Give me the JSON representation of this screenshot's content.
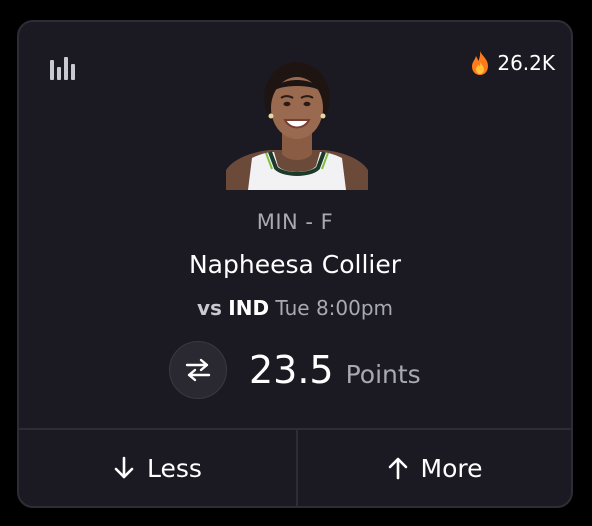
{
  "card": {
    "popularity_count": "26.2K",
    "popularity_icon": "flame-icon",
    "stats_icon": "bar-chart-icon",
    "player": {
      "team_position": "MIN - F",
      "name": "Napheesa Collier"
    },
    "matchup": {
      "vs_label": "vs",
      "opponent": "IND",
      "time": "Tue 8:00pm"
    },
    "projection": {
      "line": "23.5",
      "stat": "Points",
      "swap_icon": "swap-arrows-icon"
    },
    "actions": {
      "less_label": "Less",
      "less_icon": "arrow-down-icon",
      "more_label": "More",
      "more_icon": "arrow-up-icon"
    }
  },
  "colors": {
    "page_bg": "#000000",
    "card_bg": "#1b1a22",
    "border": "#2e2d36",
    "text_primary": "#ffffff",
    "text_secondary": "#a9a9b2",
    "flame": "#ff7a1a"
  }
}
